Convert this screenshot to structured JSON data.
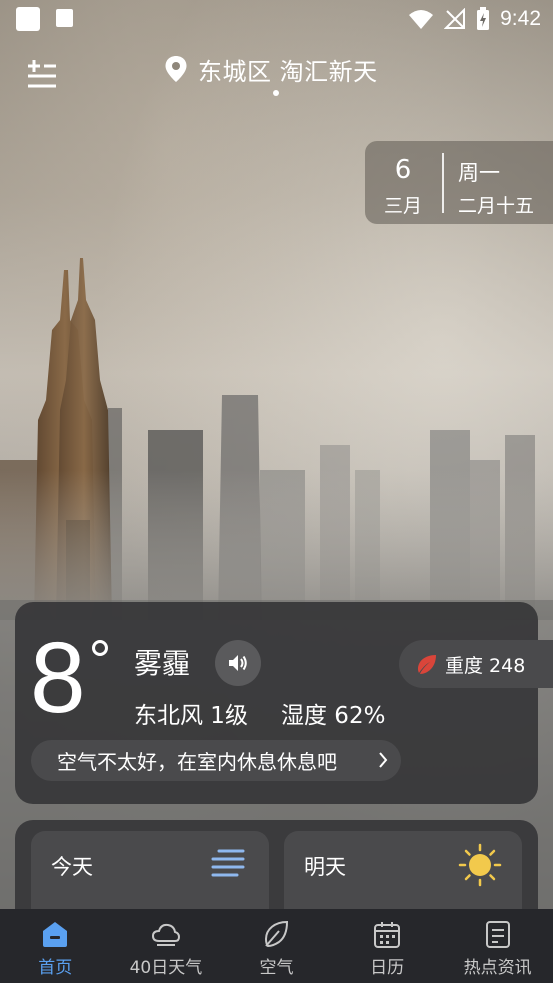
{
  "status_bar": {
    "time": "9:42"
  },
  "header": {
    "location": "东城区 淘汇新天",
    "date_day": "6",
    "date_month": "三月",
    "weekday": "周一",
    "lunar_date": "二月十五"
  },
  "current": {
    "temperature": "8",
    "condition": "雾霾",
    "wind": "东北风 1级",
    "humidity": "湿度 62%",
    "aqi_label": "重度 248",
    "tip": "空气不太好，在室内休息休息吧"
  },
  "forecast": {
    "today_label": "今天",
    "tomorrow_label": "明天"
  },
  "nav": {
    "items": [
      {
        "label": "首页",
        "icon": "home-icon",
        "active": true
      },
      {
        "label": "40日天气",
        "icon": "cloud-icon",
        "active": false
      },
      {
        "label": "空气",
        "icon": "leaf-icon",
        "active": false
      },
      {
        "label": "日历",
        "icon": "calendar-icon",
        "active": false
      },
      {
        "label": "热点资讯",
        "icon": "news-icon",
        "active": false
      }
    ]
  },
  "colors": {
    "accent": "#5aa0f0",
    "card_bg": "#373739",
    "nav_bg": "#26272b",
    "aqi_leaf": "#d9453a",
    "sun": "#f2c94c"
  }
}
